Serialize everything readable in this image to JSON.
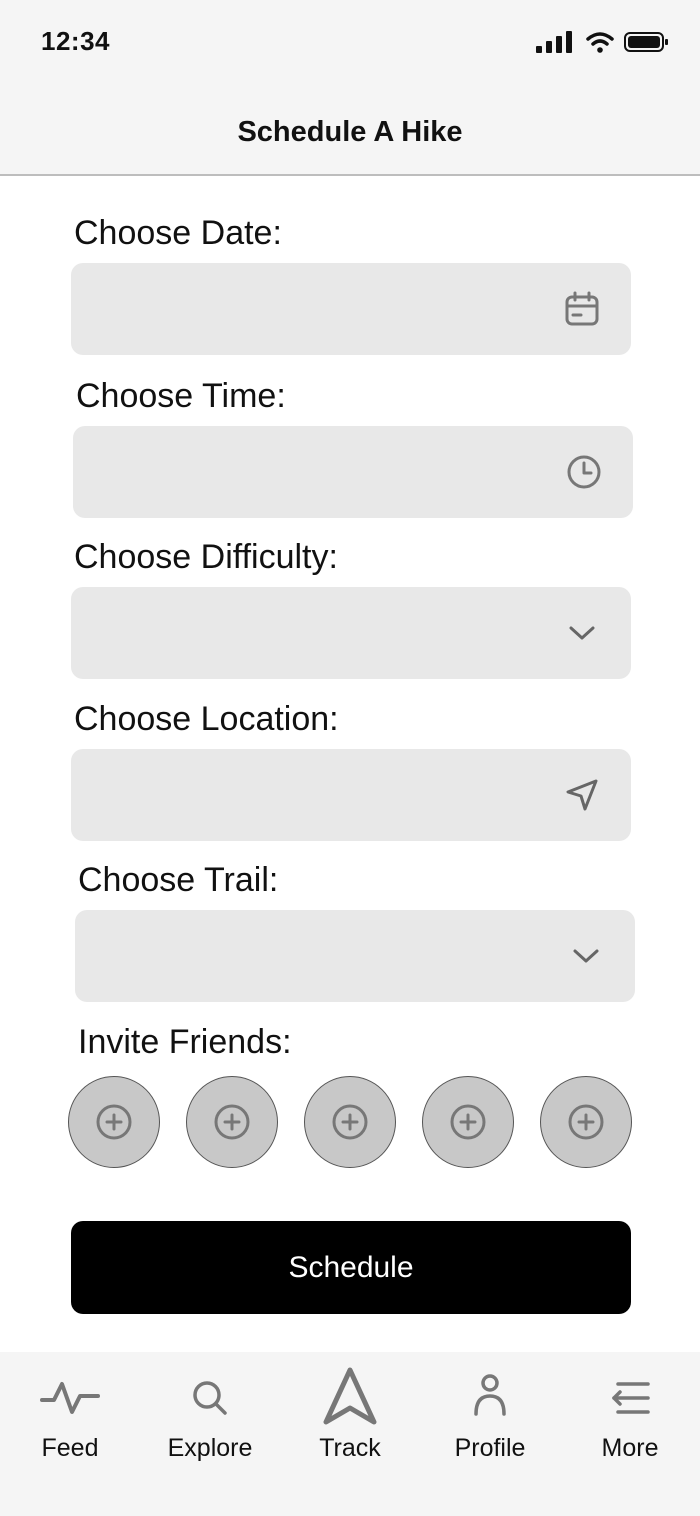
{
  "status_bar": {
    "time": "12:34"
  },
  "header": {
    "title": "Schedule A Hike"
  },
  "form": {
    "date": {
      "label": "Choose Date:",
      "value": "",
      "icon": "calendar-icon"
    },
    "time": {
      "label": "Choose Time:",
      "value": "",
      "icon": "clock-icon"
    },
    "difficulty": {
      "label": "Choose Difficulty:",
      "value": "",
      "icon": "chevron-down-icon"
    },
    "location": {
      "label": "Choose Location:",
      "value": "",
      "icon": "location-arrow-icon"
    },
    "trail": {
      "label": "Choose Trail:",
      "value": "",
      "icon": "chevron-down-icon"
    },
    "friends": {
      "label": "Invite Friends:",
      "slot_count": 5,
      "slot_icon": "add-circle-icon"
    }
  },
  "schedule_button": {
    "label": "Schedule",
    "color": "#000000"
  },
  "tab_bar": {
    "items": [
      {
        "label": "Feed",
        "icon": "activity-pulse-icon"
      },
      {
        "label": "Explore",
        "icon": "search-icon"
      },
      {
        "label": "Track",
        "icon": "navigation-arrow-icon"
      },
      {
        "label": "Profile",
        "icon": "person-icon"
      },
      {
        "label": "More",
        "icon": "menu-lines-icon"
      }
    ]
  },
  "colors": {
    "field_bg": "#e8e8e8",
    "slot_bg": "#c8c8c8",
    "icon_gray": "#777777"
  }
}
